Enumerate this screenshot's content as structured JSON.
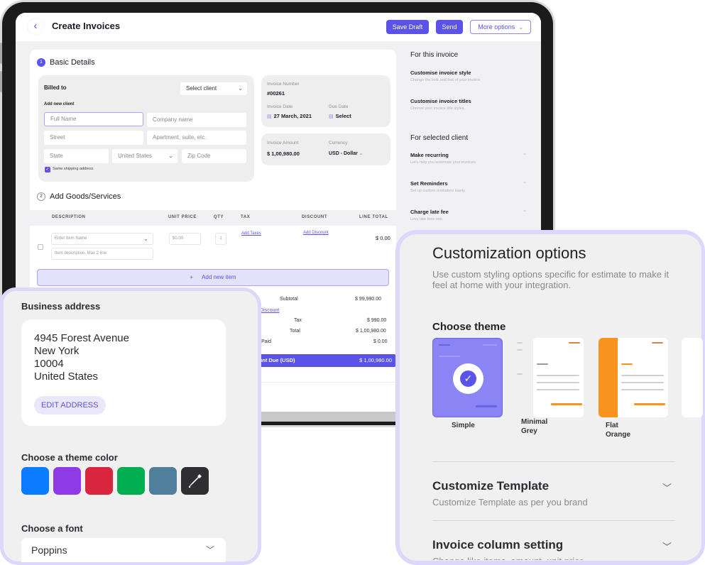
{
  "app": {
    "title": "Create Invoices",
    "buttons": {
      "save_draft": "Save Draft",
      "send": "Send",
      "more_options": "More options"
    },
    "icons": {
      "back": "chevron-left-icon",
      "more_chevron": "chevron-down-icon"
    }
  },
  "basic_details": {
    "step": "1",
    "title": "Basic Details",
    "billed_to_label": "Billed to",
    "select_client": "Select client",
    "add_new_client": "Add new client",
    "fields": {
      "full_name": "Full Name",
      "company_name": "Company name",
      "street": "Street",
      "apartment": "Apartment, suite, etc.",
      "state": "State",
      "country": "United States",
      "zip": "Zip Code"
    },
    "same_shipping": "Same shipping address",
    "same_shipping_checked": true
  },
  "invoice_info": {
    "number_label": "Invoice Number",
    "number": "#00261",
    "date_label": "Invoice Date",
    "date": "27 March, 2021",
    "due_label": "Due Date",
    "due": "Select",
    "amount_label": "Invoice Amount",
    "amount": "$ 1,00,980.00",
    "currency_label": "Currency",
    "currency": "USD - Dollar"
  },
  "goods": {
    "step": "2",
    "title": "Add Goods/Services",
    "columns": [
      "DESCRIPTION",
      "UNIT PRICE",
      "QTY",
      "TAX",
      "DISCOUNT",
      "LINE TOTAL"
    ],
    "row": {
      "item_placeholder": "Enter Item Name",
      "desc_placeholder": "Item description. Max 2 line",
      "price_placeholder": "$0.00",
      "qty": "1",
      "add_taxes": "Add Taxes",
      "add_discount": "Add Discount",
      "line_total": "$ 0.00"
    },
    "add_item": "Add new item"
  },
  "summary": {
    "subtotal_label": "Subtotal",
    "subtotal": "$ 99,990.00",
    "invoice_discount": "Invoice Discount",
    "tax_label": "Tax",
    "tax": "$ 990.00",
    "total_label": "Total",
    "total": "$ 1,00,980.00",
    "paid_label": "Amount Paid",
    "paid": "$ 0.00",
    "due_label": "Amount Due (USD)",
    "due": "$ 1,00,980.00"
  },
  "sidebar": {
    "for_invoice": "For this invoice",
    "invoice_items": [
      {
        "title": "Customise invoice style",
        "sub": "Change the look and feel of your invoice"
      },
      {
        "title": "Customise invoice titles",
        "sub": "Choose your invoice title styles."
      }
    ],
    "for_client": "For selected client",
    "client_items": [
      {
        "title": "Make recurring",
        "sub": "Let's help you automate your invoices."
      },
      {
        "title": "Set Reminders",
        "sub": "Set up custom reminders easily."
      },
      {
        "title": "Charge late fee",
        "sub": "Levy late fees rate."
      }
    ]
  },
  "business": {
    "title": "Business address",
    "address": [
      "4945  Forest Avenue",
      "New York",
      "10004",
      "United States"
    ],
    "edit": "EDIT ADDRESS",
    "theme_color_title": "Choose a theme color",
    "colors": [
      "#0a7cff",
      "#8e3be6",
      "#d8263f",
      "#00ad50",
      "#4f7f9a"
    ],
    "picker_icon": "eyedropper-icon",
    "font_title": "Choose a font",
    "font": "Poppins"
  },
  "customization": {
    "title": "Customization options",
    "subtitle": "Use custom styling options specific for estimate to make it feel at home with your integration.",
    "choose_theme": "Choose theme",
    "themes": [
      {
        "name": "Simple",
        "selected": true
      },
      {
        "name": "Minimal Grey",
        "selected": false
      },
      {
        "name": "Flat Orange",
        "selected": false
      }
    ],
    "accordions": [
      {
        "title": "Customize Template",
        "sub": "Customize Template as per you brand"
      },
      {
        "title": "Invoice column setting",
        "sub": "Change like items, amount, unit price"
      }
    ]
  },
  "colors": {
    "accent": "#5b52e8",
    "accent_light": "#e4e1fb",
    "panel_border": "#dcd8fb",
    "orange": "#f7931e"
  }
}
